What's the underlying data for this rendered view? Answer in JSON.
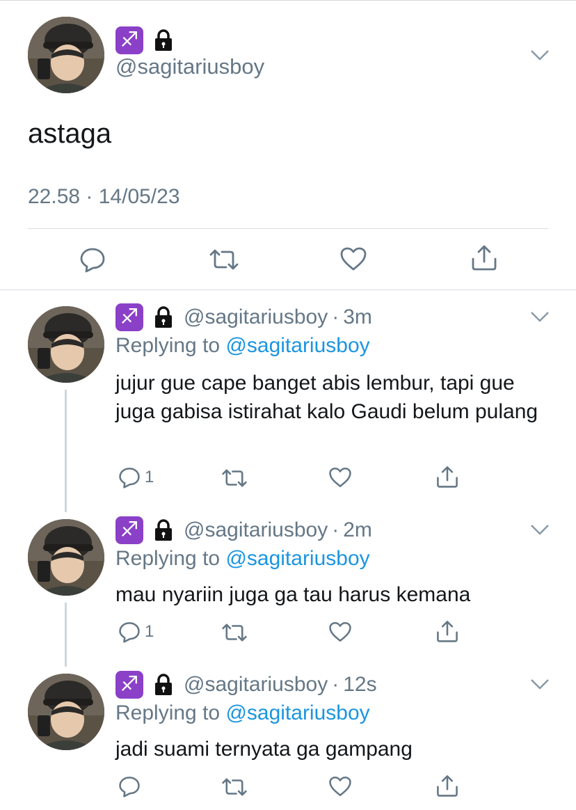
{
  "main_tweet": {
    "badge_emoji": "♐",
    "lock_icon": "lock-icon",
    "handle": "@sagitariusboy",
    "text": "astaga",
    "timestamp": "22.58 · 14/05/23",
    "actions": {
      "reply_icon": "reply-icon",
      "retweet_icon": "retweet-icon",
      "like_icon": "like-icon",
      "share_icon": "share-icon"
    }
  },
  "replies": [
    {
      "handle": "@sagitariusboy",
      "time": "3m",
      "replying_label": "Replying to",
      "replying_to": "@sagitariusboy",
      "text": "jujur gue cape banget abis lembur, tapi gue juga gabisa istirahat kalo Gaudi belum pulang",
      "reply_count": "1"
    },
    {
      "handle": "@sagitariusboy",
      "time": "2m",
      "replying_label": "Replying to",
      "replying_to": "@sagitariusboy",
      "text": "mau nyariin juga ga tau harus kemana",
      "reply_count": "1"
    },
    {
      "handle": "@sagitariusboy",
      "time": "12s",
      "replying_label": "Replying to",
      "replying_to": "@sagitariusboy",
      "text": "jadi suami ternyata ga gampang",
      "reply_count": ""
    }
  ],
  "colors": {
    "link": "#1b95e0",
    "secondary_text": "#657786",
    "badge_purple": "#8b40c8"
  }
}
